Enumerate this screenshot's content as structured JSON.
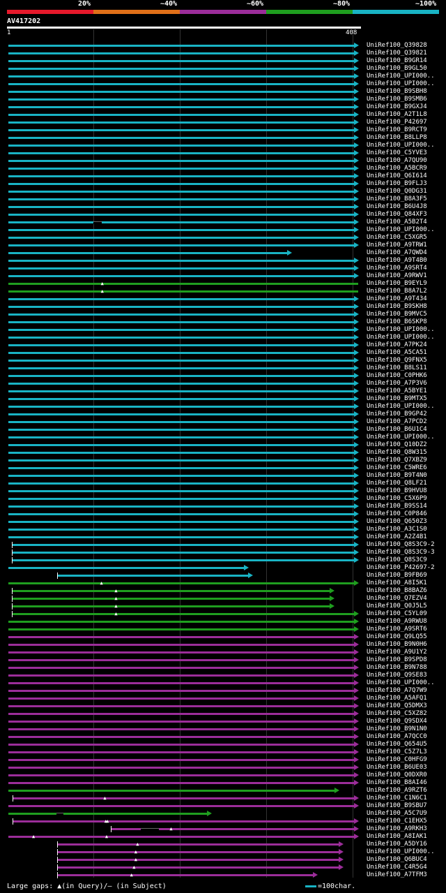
{
  "legend": {
    "segments": [
      {
        "label": "20%",
        "color": "#e6192b"
      },
      {
        "label": "~40%",
        "color": "#e07019"
      },
      {
        "label": "~60%",
        "color": "#9b2d99"
      },
      {
        "label": "~80%",
        "color": "#1f9e1f"
      },
      {
        "label": "~100%",
        "color": "#19b3c4"
      }
    ]
  },
  "query": {
    "id": "AV417202",
    "start": "1",
    "end": "408",
    "length": 408
  },
  "footer": {
    "gaps_text": "Large gaps: ▲(in Query)/— (in Subject)",
    "scale_text": "=100char."
  },
  "colors": {
    "cyan": "#19b3c4",
    "green": "#1f9e1f",
    "purple": "#9b2d99"
  },
  "hits": [
    {
      "name": "UniRef100_Q39828",
      "s": 1,
      "e": 408,
      "c": "cyan",
      "a": 1
    },
    {
      "name": "UniRef100_Q39821",
      "s": 1,
      "e": 408,
      "c": "cyan",
      "a": 1
    },
    {
      "name": "UniRef100_B9GR14",
      "s": 1,
      "e": 408,
      "c": "cyan",
      "a": 1
    },
    {
      "name": "UniRef100_B9GL50",
      "s": 1,
      "e": 408,
      "c": "cyan",
      "a": 1
    },
    {
      "name": "UniRef100_UPI000..",
      "s": 1,
      "e": 408,
      "c": "cyan",
      "a": 1
    },
    {
      "name": "UniRef100_UPI000..",
      "s": 1,
      "e": 408,
      "c": "cyan",
      "a": 1
    },
    {
      "name": "UniRef100_B9SBH8",
      "s": 1,
      "e": 408,
      "c": "cyan",
      "a": 1
    },
    {
      "name": "UniRef100_B9SMB6",
      "s": 1,
      "e": 408,
      "c": "cyan",
      "a": 1
    },
    {
      "name": "UniRef100_B9GXJ4",
      "s": 1,
      "e": 408,
      "c": "cyan",
      "a": 1
    },
    {
      "name": "UniRef100_A2T1L8",
      "s": 1,
      "e": 408,
      "c": "cyan",
      "a": 1
    },
    {
      "name": "UniRef100_P42697",
      "s": 1,
      "e": 408,
      "c": "cyan",
      "a": 1
    },
    {
      "name": "UniRef100_B9RCT9",
      "s": 1,
      "e": 408,
      "c": "cyan",
      "a": 1
    },
    {
      "name": "UniRef100_B8LLP8",
      "s": 1,
      "e": 408,
      "c": "cyan",
      "a": 1
    },
    {
      "name": "UniRef100_UPI000..",
      "s": 1,
      "e": 408,
      "c": "cyan",
      "a": 1
    },
    {
      "name": "UniRef100_C5YVE3",
      "s": 1,
      "e": 408,
      "c": "cyan",
      "a": 1
    },
    {
      "name": "UniRef100_A7QU90",
      "s": 1,
      "e": 408,
      "c": "cyan",
      "a": 1
    },
    {
      "name": "UniRef100_A5BCR9",
      "s": 1,
      "e": 408,
      "c": "cyan",
      "a": 1
    },
    {
      "name": "UniRef100_Q6I614",
      "s": 1,
      "e": 408,
      "c": "cyan",
      "a": 1
    },
    {
      "name": "UniRef100_B9FLJ3",
      "s": 1,
      "e": 408,
      "c": "cyan",
      "a": 1
    },
    {
      "name": "UniRef100_Q0DG31",
      "s": 1,
      "e": 408,
      "c": "cyan",
      "a": 1
    },
    {
      "name": "UniRef100_B8A3F5",
      "s": 1,
      "e": 408,
      "c": "cyan",
      "a": 1
    },
    {
      "name": "UniRef100_B6U4J8",
      "s": 1,
      "e": 408,
      "c": "cyan",
      "a": 1
    },
    {
      "name": "UniRef100_Q84XF3",
      "s": 1,
      "e": 408,
      "c": "cyan",
      "a": 1
    },
    {
      "name": "UniRef100_A5B2T4",
      "s": 1,
      "e": 408,
      "c": "cyan",
      "a": 1,
      "sg": [
        100,
        110
      ]
    },
    {
      "name": "UniRef100_UPI000..",
      "s": 1,
      "e": 408,
      "c": "cyan",
      "a": 1
    },
    {
      "name": "UniRef100_C5XGR5",
      "s": 1,
      "e": 408,
      "c": "cyan",
      "a": 1
    },
    {
      "name": "UniRef100_A9TRW1",
      "s": 1,
      "e": 408,
      "c": "cyan",
      "a": 1
    },
    {
      "name": "UniRef100_A7QWD4",
      "s": 1,
      "e": 330,
      "c": "cyan",
      "a": 1
    },
    {
      "name": "UniRef100_A9T4B0",
      "s": 1,
      "e": 408,
      "c": "cyan",
      "a": 1
    },
    {
      "name": "UniRef100_A9SRT4",
      "s": 1,
      "e": 408,
      "c": "cyan",
      "a": 1
    },
    {
      "name": "UniRef100_A9RWV1",
      "s": 1,
      "e": 408,
      "c": "cyan",
      "a": 1
    },
    {
      "name": "UniRef100_B9EYL9",
      "s": 1,
      "e": 408,
      "c": "green",
      "a": 0,
      "qg": [
        111
      ]
    },
    {
      "name": "UniRef100_B8A7L2",
      "s": 1,
      "e": 408,
      "c": "green",
      "a": 0,
      "qg": [
        111
      ]
    },
    {
      "name": "UniRef100_A9T434",
      "s": 1,
      "e": 408,
      "c": "cyan",
      "a": 1
    },
    {
      "name": "UniRef100_B9SKH8",
      "s": 1,
      "e": 408,
      "c": "cyan",
      "a": 1
    },
    {
      "name": "UniRef100_B9MVC5",
      "s": 1,
      "e": 408,
      "c": "cyan",
      "a": 1
    },
    {
      "name": "UniRef100_B6SKP8",
      "s": 1,
      "e": 408,
      "c": "cyan",
      "a": 1
    },
    {
      "name": "UniRef100_UPI000..",
      "s": 1,
      "e": 408,
      "c": "cyan",
      "a": 1
    },
    {
      "name": "UniRef100_UPI000..",
      "s": 1,
      "e": 408,
      "c": "cyan",
      "a": 1
    },
    {
      "name": "UniRef100_A7PK24",
      "s": 1,
      "e": 408,
      "c": "cyan",
      "a": 1
    },
    {
      "name": "UniRef100_A5CA51",
      "s": 1,
      "e": 408,
      "c": "cyan",
      "a": 1
    },
    {
      "name": "UniRef100_Q9FNX5",
      "s": 1,
      "e": 408,
      "c": "cyan",
      "a": 1
    },
    {
      "name": "UniRef100_B8LS11",
      "s": 1,
      "e": 408,
      "c": "cyan",
      "a": 1
    },
    {
      "name": "UniRef100_C0PHK6",
      "s": 1,
      "e": 408,
      "c": "cyan",
      "a": 1
    },
    {
      "name": "UniRef100_A7P3V6",
      "s": 1,
      "e": 408,
      "c": "cyan",
      "a": 1
    },
    {
      "name": "UniRef100_A5BYE1",
      "s": 1,
      "e": 408,
      "c": "cyan",
      "a": 1
    },
    {
      "name": "UniRef100_B9MTX5",
      "s": 1,
      "e": 408,
      "c": "cyan",
      "a": 1
    },
    {
      "name": "UniRef100_UPI000..",
      "s": 1,
      "e": 408,
      "c": "cyan",
      "a": 1
    },
    {
      "name": "UniRef100_B9GP42",
      "s": 1,
      "e": 408,
      "c": "cyan",
      "a": 1
    },
    {
      "name": "UniRef100_A7PCD2",
      "s": 1,
      "e": 408,
      "c": "cyan",
      "a": 1
    },
    {
      "name": "UniRef100_B6U1C4",
      "s": 1,
      "e": 408,
      "c": "cyan",
      "a": 1
    },
    {
      "name": "UniRef100_UPI000..",
      "s": 1,
      "e": 408,
      "c": "cyan",
      "a": 1
    },
    {
      "name": "UniRef100_Q10DZ2",
      "s": 1,
      "e": 408,
      "c": "cyan",
      "a": 1
    },
    {
      "name": "UniRef100_Q8W315",
      "s": 1,
      "e": 408,
      "c": "cyan",
      "a": 1
    },
    {
      "name": "UniRef100_Q7XBZ9",
      "s": 1,
      "e": 408,
      "c": "cyan",
      "a": 1
    },
    {
      "name": "UniRef100_C5WRE6",
      "s": 1,
      "e": 408,
      "c": "cyan",
      "a": 1
    },
    {
      "name": "UniRef100_B9T4N0",
      "s": 1,
      "e": 408,
      "c": "cyan",
      "a": 1
    },
    {
      "name": "UniRef100_Q8LF21",
      "s": 1,
      "e": 408,
      "c": "cyan",
      "a": 1
    },
    {
      "name": "UniRef100_B9HVU8",
      "s": 1,
      "e": 408,
      "c": "cyan",
      "a": 1
    },
    {
      "name": "UniRef100_C5X6P9",
      "s": 1,
      "e": 408,
      "c": "cyan",
      "a": 1
    },
    {
      "name": "UniRef100_B9SS14",
      "s": 1,
      "e": 408,
      "c": "cyan",
      "a": 1
    },
    {
      "name": "UniRef100_C0P846",
      "s": 1,
      "e": 408,
      "c": "cyan",
      "a": 1
    },
    {
      "name": "UniRef100_Q650Z3",
      "s": 1,
      "e": 408,
      "c": "cyan",
      "a": 1
    },
    {
      "name": "UniRef100_A3C1S0",
      "s": 1,
      "e": 408,
      "c": "cyan",
      "a": 1
    },
    {
      "name": "UniRef100_A2Z4B1",
      "s": 1,
      "e": 408,
      "c": "cyan",
      "a": 1
    },
    {
      "name": "UniRef100_Q8S3C9-2",
      "s": 5,
      "e": 408,
      "c": "cyan",
      "a": 1
    },
    {
      "name": "UniRef100_Q8S3C9-3",
      "s": 5,
      "e": 408,
      "c": "cyan",
      "a": 1
    },
    {
      "name": "UniRef100_Q8S3C9",
      "s": 5,
      "e": 408,
      "c": "cyan",
      "a": 1
    },
    {
      "name": "UniRef100_P42697-2",
      "s": 1,
      "e": 280,
      "c": "cyan",
      "a": 1
    },
    {
      "name": "UniRef100_B9FB69",
      "s": 58,
      "e": 285,
      "c": "cyan",
      "a": 1
    },
    {
      "name": "UniRef100_A8I5K1",
      "s": 1,
      "e": 408,
      "c": "green",
      "a": 1,
      "qg": [
        110
      ]
    },
    {
      "name": "UniRef100_B8BAZ6",
      "s": 5,
      "e": 380,
      "c": "green",
      "a": 1,
      "qg": [
        127
      ]
    },
    {
      "name": "UniRef100_Q7EZV4",
      "s": 5,
      "e": 380,
      "c": "green",
      "a": 1,
      "qg": [
        127
      ]
    },
    {
      "name": "UniRef100_Q0J5L5",
      "s": 5,
      "e": 380,
      "c": "green",
      "a": 1,
      "qg": [
        127
      ]
    },
    {
      "name": "UniRef100_C5YL09",
      "s": 5,
      "e": 408,
      "c": "green",
      "a": 1,
      "qg": [
        127
      ]
    },
    {
      "name": "UniRef100_A9RWU8",
      "s": 1,
      "e": 408,
      "c": "green",
      "a": 1
    },
    {
      "name": "UniRef100_A9SRT6",
      "s": 1,
      "e": 408,
      "c": "green",
      "a": 1
    },
    {
      "name": "UniRef100_Q9LQ55",
      "s": 1,
      "e": 408,
      "c": "purple",
      "a": 1
    },
    {
      "name": "UniRef100_B9N0H6",
      "s": 1,
      "e": 408,
      "c": "purple",
      "a": 1
    },
    {
      "name": "UniRef100_A9U1Y2",
      "s": 1,
      "e": 408,
      "c": "purple",
      "a": 1
    },
    {
      "name": "UniRef100_B9SPD8",
      "s": 1,
      "e": 408,
      "c": "purple",
      "a": 1
    },
    {
      "name": "UniRef100_B9N788",
      "s": 1,
      "e": 408,
      "c": "purple",
      "a": 1
    },
    {
      "name": "UniRef100_Q9SE83",
      "s": 1,
      "e": 408,
      "c": "purple",
      "a": 1
    },
    {
      "name": "UniRef100_UPI000..",
      "s": 1,
      "e": 408,
      "c": "purple",
      "a": 1
    },
    {
      "name": "UniRef100_A7Q7W9",
      "s": 1,
      "e": 408,
      "c": "purple",
      "a": 1
    },
    {
      "name": "UniRef100_A5AFQ1",
      "s": 1,
      "e": 408,
      "c": "purple",
      "a": 1
    },
    {
      "name": "UniRef100_Q5DMX3",
      "s": 1,
      "e": 408,
      "c": "purple",
      "a": 1
    },
    {
      "name": "UniRef100_C5XZ82",
      "s": 1,
      "e": 408,
      "c": "purple",
      "a": 1
    },
    {
      "name": "UniRef100_Q9SDX4",
      "s": 1,
      "e": 408,
      "c": "purple",
      "a": 1
    },
    {
      "name": "UniRef100_B9N1N0",
      "s": 1,
      "e": 408,
      "c": "purple",
      "a": 1
    },
    {
      "name": "UniRef100_A7QCC0",
      "s": 1,
      "e": 408,
      "c": "purple",
      "a": 1
    },
    {
      "name": "UniRef100_Q654U5",
      "s": 1,
      "e": 408,
      "c": "purple",
      "a": 1
    },
    {
      "name": "UniRef100_C5Z7L3",
      "s": 1,
      "e": 408,
      "c": "purple",
      "a": 1
    },
    {
      "name": "UniRef100_C0HFG9",
      "s": 1,
      "e": 408,
      "c": "purple",
      "a": 1
    },
    {
      "name": "UniRef100_B6UE03",
      "s": 1,
      "e": 408,
      "c": "purple",
      "a": 1
    },
    {
      "name": "UniRef100_Q0DXR0",
      "s": 1,
      "e": 408,
      "c": "purple",
      "a": 1
    },
    {
      "name": "UniRef100_B8AI46",
      "s": 1,
      "e": 408,
      "c": "purple",
      "a": 1
    },
    {
      "name": "UniRef100_A9RZT6",
      "s": 1,
      "e": 385,
      "c": "green",
      "a": 1
    },
    {
      "name": "UniRef100_C1N6C1",
      "s": 6,
      "e": 408,
      "c": "purple",
      "a": 1,
      "qg": [
        114
      ]
    },
    {
      "name": "UniRef100_B9SBU7",
      "s": 1,
      "e": 408,
      "c": "purple",
      "a": 1
    },
    {
      "name": "UniRef100_A5C7U9",
      "s": 1,
      "e": 237,
      "c": "green",
      "a": 1,
      "sg": [
        57,
        65
      ]
    },
    {
      "name": "UniRef100_C1EHX5",
      "s": 6,
      "e": 408,
      "c": "purple",
      "a": 1,
      "qg": [
        115,
        117
      ]
    },
    {
      "name": "UniRef100_A9RKH3",
      "s": 120,
      "e": 408,
      "c": "purple",
      "a": 1,
      "qg": [
        191
      ],
      "sg": [
        155,
        176
      ]
    },
    {
      "name": "UniRef100_A8IAK1",
      "s": 1,
      "e": 408,
      "c": "purple",
      "a": 1,
      "qg": [
        31,
        116
      ]
    },
    {
      "name": "UniRef100_A5DY16",
      "s": 58,
      "e": 390,
      "c": "purple",
      "a": 1,
      "qg": [
        152
      ]
    },
    {
      "name": "UniRef100_UPI000..",
      "s": 58,
      "e": 390,
      "c": "purple",
      "a": 1,
      "qg": [
        150
      ]
    },
    {
      "name": "UniRef100_Q6BUC4",
      "s": 58,
      "e": 390,
      "c": "purple",
      "a": 1,
      "qg": [
        150
      ]
    },
    {
      "name": "UniRef100_C4R5G4",
      "s": 58,
      "e": 390,
      "c": "purple",
      "a": 1,
      "qg": [
        148
      ]
    },
    {
      "name": "UniRef100_A7TFM3",
      "s": 58,
      "e": 360,
      "c": "purple",
      "a": 1,
      "qg": [
        145
      ]
    }
  ]
}
